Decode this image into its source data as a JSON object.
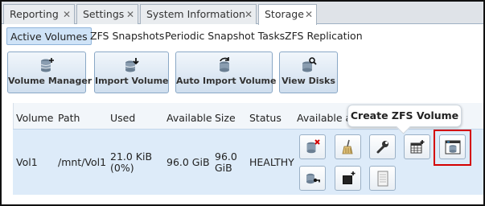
{
  "tabs": [
    {
      "label": "Reporting"
    },
    {
      "label": "Settings"
    },
    {
      "label": "System Information"
    },
    {
      "label": "Storage",
      "active": true
    }
  ],
  "subtabs": [
    "Active Volumes",
    "ZFS Snapshots",
    "Periodic Snapshot Tasks",
    "ZFS Replication"
  ],
  "toolbar": [
    "Volume Manager",
    "Import Volume",
    "Auto Import Volume",
    "View Disks"
  ],
  "table": {
    "headers": [
      "Volume",
      "Path",
      "Used",
      "Available",
      "Size",
      "Status",
      "Available a"
    ],
    "row": {
      "volume": "Vol1",
      "path": "/mnt/Vol1",
      "used_line1": "21.0 KiB",
      "used_line2": "(0%)",
      "available": "96.0 GiB",
      "size_line1": "96.0",
      "size_line2": "GiB",
      "status": "HEALTHY"
    }
  },
  "tooltip": "Create ZFS Volume",
  "colors": {
    "active_subtab": "#cfe3f7",
    "row_selected": "#ddebf9",
    "highlight": "#d40000"
  },
  "icons": {
    "toolbar": [
      "database-add-icon",
      "database-import-icon",
      "database-refresh-icon",
      "database-search-icon"
    ],
    "actions": [
      "detach-volume-icon",
      "scrub-volume-icon",
      "settings-wrench-icon",
      "create-dataset-icon",
      "create-zvol-icon",
      "encryption-key-icon",
      "change-permissions-icon",
      "volume-status-icon"
    ]
  }
}
